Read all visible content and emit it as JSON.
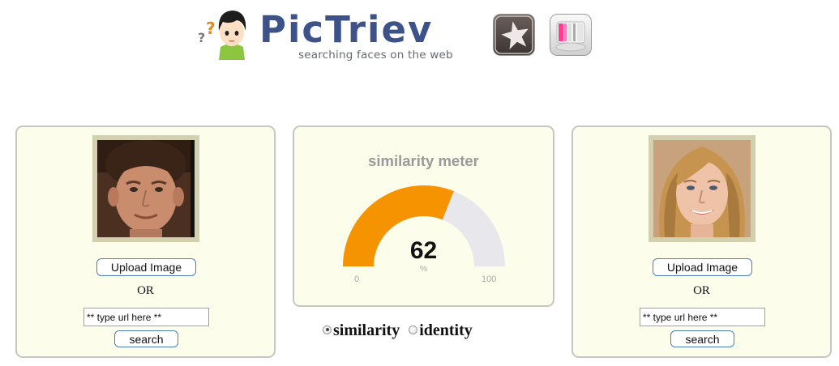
{
  "header": {
    "logo_title": "PicTriev",
    "logo_tagline": "searching faces on the web",
    "icons": [
      "star-app-icon",
      "pink-app-icon"
    ]
  },
  "left_panel": {
    "upload_label": "Upload Image",
    "or_label": "OR",
    "url_value": "** type url here **",
    "search_label": "search"
  },
  "meter": {
    "title": "similarity meter",
    "value": "62",
    "unit": "%",
    "min": "0",
    "max": "100",
    "fraction": 0.62
  },
  "right_panel": {
    "upload_label": "Upload Image",
    "or_label": "OR",
    "url_value": "** type url here **",
    "search_label": "search"
  },
  "modes": {
    "similarity_label": "similarity",
    "identity_label": "identity",
    "selected": "similarity"
  },
  "colors": {
    "brand": "#3d5288",
    "gauge_fill": "#f59400",
    "gauge_track": "#e8e8ec",
    "panel_bg": "#fdfdec",
    "panel_border": "#c6c6c2"
  }
}
